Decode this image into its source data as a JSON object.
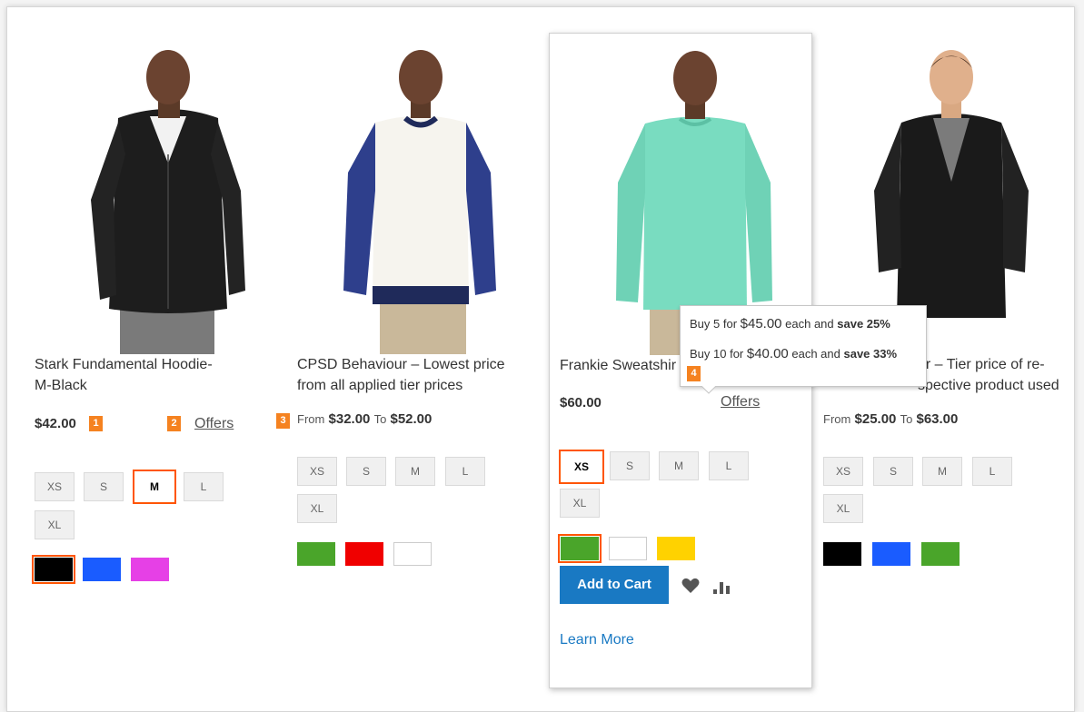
{
  "products": [
    {
      "name": "Stark Fundamental Hoodie-M-Black",
      "name_line1": "Stark Fundamental Hoodie-",
      "name_line2": "M-Black",
      "price": "$42.00",
      "badge1": "1",
      "badge2": "2",
      "offers_label": "Offers",
      "sizes": [
        "XS",
        "S",
        "M",
        "L",
        "XL"
      ],
      "selected_size": "M",
      "colors": [
        "#000000",
        "#1a5cff",
        "#e640e6"
      ],
      "selected_color": "#000000"
    },
    {
      "name_line1": "CPSD Behaviour – Lowest price",
      "name_line2": "from all applied tier prices",
      "badge": "3",
      "from_label": "From",
      "price_from": "$32.00",
      "to_label": "To",
      "price_to": "$52.00",
      "sizes": [
        "XS",
        "S",
        "M",
        "L",
        "XL"
      ],
      "colors": [
        "#4aa52a",
        "#f00000",
        "#ffffff"
      ]
    },
    {
      "name_line1": "Frankie Sweatshir",
      "price": "$60.00",
      "offers_label": "Offers",
      "badge": "4",
      "sizes": [
        "XS",
        "S",
        "M",
        "L",
        "XL"
      ],
      "selected_size": "XS",
      "colors": [
        "#4aa52a",
        "#ffffff",
        "#ffd200"
      ],
      "selected_color": "#4aa52a",
      "add_to_cart": "Add to Cart",
      "learn_more": "Learn More",
      "tooltip": {
        "row1_prefix": "Buy 5 for ",
        "row1_price": "$45.00",
        "row1_mid": " each and ",
        "row1_save": "save 25%",
        "row2_prefix": "Buy 10 for ",
        "row2_price": "$40.00",
        "row2_mid": " each and ",
        "row2_save": "save 33%"
      }
    },
    {
      "name_line1": "ur – Tier price of re-",
      "name_line2": "spective product used",
      "from_label": "From",
      "price_from": "$25.00",
      "to_label": "To",
      "price_to": "$63.00",
      "sizes": [
        "XS",
        "S",
        "M",
        "L",
        "XL"
      ],
      "colors": [
        "#000000",
        "#1a5cff",
        "#4aa52a"
      ]
    }
  ],
  "icon_names": [
    "heart-icon",
    "compare-icon"
  ]
}
